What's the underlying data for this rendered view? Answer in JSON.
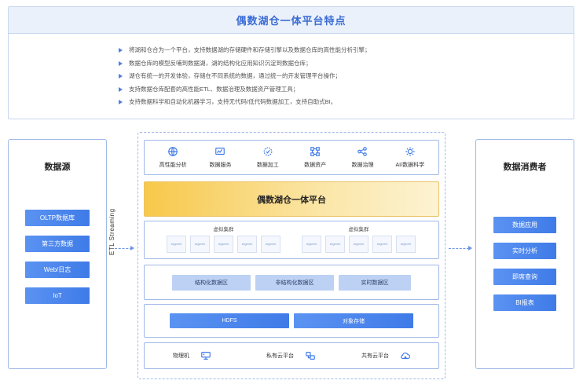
{
  "features": {
    "title": "偶数湖仓一体平台特点",
    "items": [
      "将湖和仓合为一个平台，支持数据湖的存储硬件和存储引擎以及数据仓库的高性能分析引擎；",
      "数据仓库的模型反哺到数据湖，湖的结构化应用知识沉淀到数据仓库；",
      "湖仓有统一的开发体验，存储在不同系统的数据，通过统一的开发管理平台操作；",
      "支持数据仓库配套的高性能ETL、数据治理及数据资产管理工具；",
      "支持数据科学和自动化机器学习，支持无代码/低代码数据加工，支持自助式BI。"
    ]
  },
  "sources": {
    "title": "数据源",
    "items": [
      "OLTP数据库",
      "第三方数据",
      "Web/日志",
      "IoT"
    ]
  },
  "etl_label": "ETL Streaming",
  "consumers": {
    "title": "数据消费者",
    "items": [
      "数据应用",
      "实时分析",
      "即席查询",
      "BI报表"
    ]
  },
  "capabilities": [
    {
      "label": "高性能分析",
      "icon": "globe-icon"
    },
    {
      "label": "数据服务",
      "icon": "chart-monitor-icon"
    },
    {
      "label": "数据加工",
      "icon": "gear-check-icon"
    },
    {
      "label": "数据资产",
      "icon": "network-icon"
    },
    {
      "label": "数据治理",
      "icon": "nodes-icon"
    },
    {
      "label": "AI/数据科学",
      "icon": "ai-gear-icon"
    }
  ],
  "platform": {
    "title": "偶数湖仓一体平台"
  },
  "clusters": [
    {
      "title": "虚拟集群",
      "nodes": [
        "segment",
        "segment",
        "segment",
        "segment",
        "segment"
      ]
    },
    {
      "title": "虚拟集群",
      "nodes": [
        "segment",
        "segment",
        "segment",
        "segment",
        "segment"
      ]
    }
  ],
  "zones": [
    "结构化数据区",
    "非结构化数据区",
    "实时数据区"
  ],
  "storage": [
    "HDFS",
    "对象存储"
  ],
  "infrastructure": [
    {
      "label": "物理机",
      "icon": "server-icon"
    },
    {
      "label": "私有云平台",
      "icon": "private-cloud-icon"
    },
    {
      "label": "共有云平台",
      "icon": "public-cloud-icon"
    }
  ],
  "colors": {
    "accent": "#3f7be8",
    "title_blue": "#3a6bd4",
    "platform_yellow": "#f7c84a",
    "zone_light_blue": "#bcd1f4"
  }
}
